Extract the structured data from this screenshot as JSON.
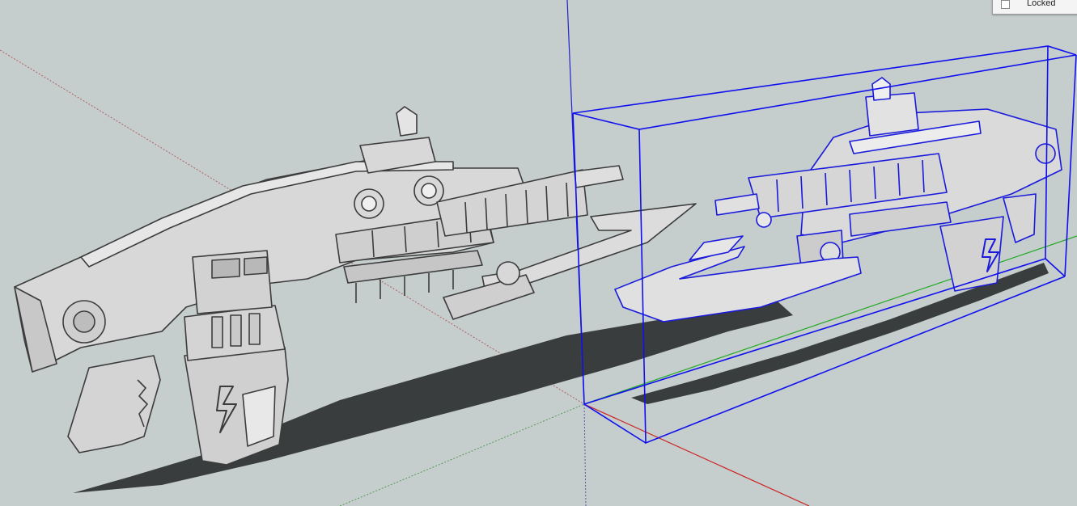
{
  "scene": {
    "background": "#c5cdcd",
    "model_color": "#d6d6d6",
    "model_dark": "#4a4a4a",
    "selection_color": "#1010ee",
    "axis_colors": {
      "red": "#cc2222",
      "green": "#22aa22",
      "blue": "#2222cc"
    }
  },
  "entity_info": {
    "locked_label": "Locked"
  }
}
